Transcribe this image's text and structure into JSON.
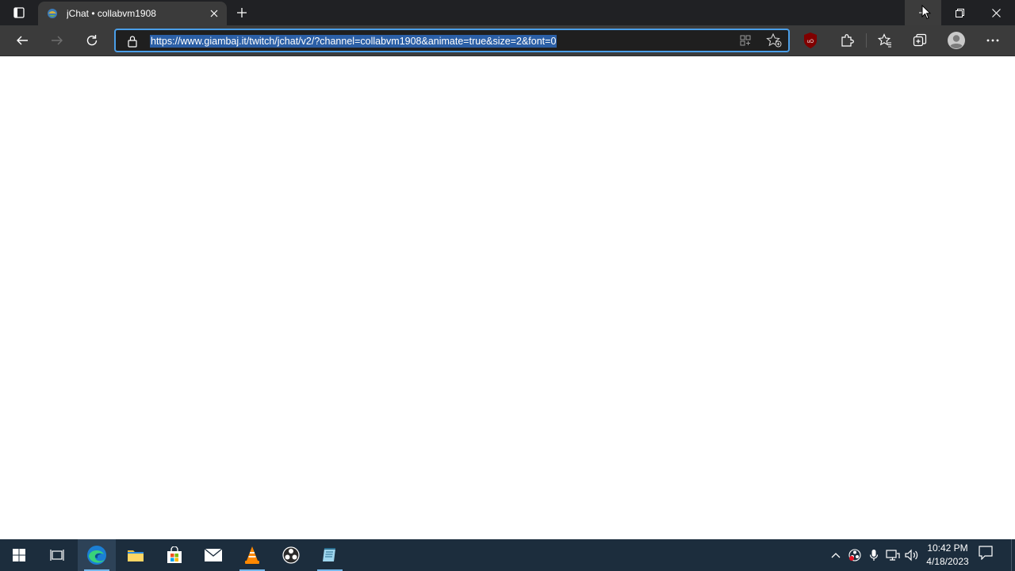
{
  "browser": {
    "tab": {
      "title": "jChat • collabvm1908"
    },
    "address": {
      "url": "https://www.giambaj.it/twitch/jchat/v2/?channel=collabvm1908&animate=true&size=2&font=0"
    }
  },
  "taskbar": {
    "clock": {
      "time": "10:42 PM",
      "date": "4/18/2023"
    },
    "apps": [
      "edge",
      "file-explorer",
      "store",
      "mail",
      "vlc",
      "obs",
      "notepad"
    ]
  },
  "colors": {
    "titlebar": "#202124",
    "toolbar": "#3b3b3b",
    "address_focus": "#4a9ee8",
    "url_selection": "#2b5fa6",
    "taskbar": "#1c2d3d"
  }
}
